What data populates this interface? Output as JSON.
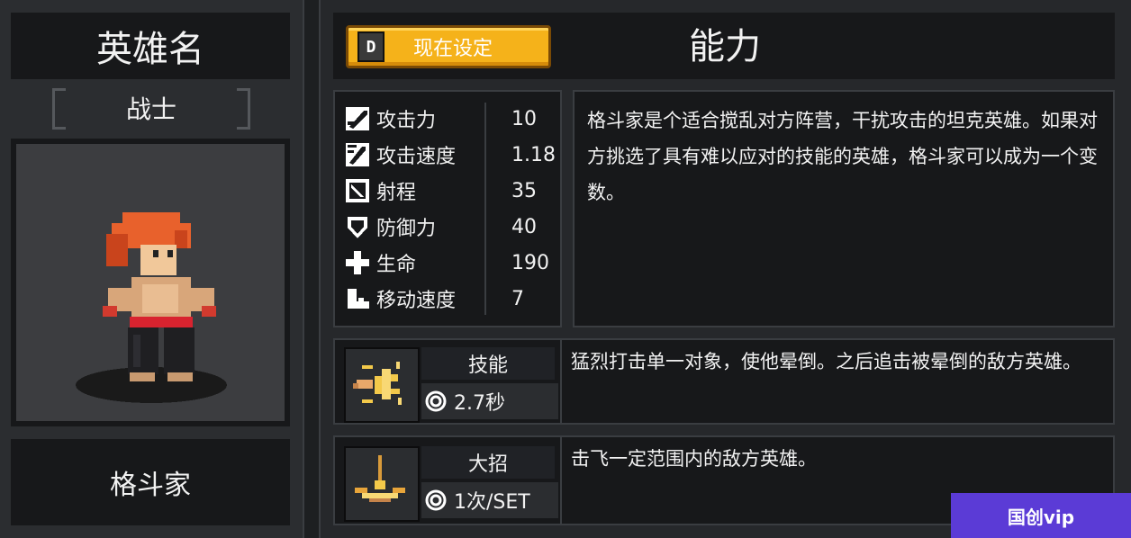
{
  "hero": {
    "title": "英雄名",
    "class": "战士",
    "name": "格斗家"
  },
  "header": {
    "set_button_key": "D",
    "set_button_label": "现在设定",
    "section_title": "能力"
  },
  "stats": [
    {
      "icon": "sword-icon",
      "label": "攻击力",
      "value": "10"
    },
    {
      "icon": "attack-speed-icon",
      "label": "攻击速度",
      "value": "1.18"
    },
    {
      "icon": "range-icon",
      "label": "射程",
      "value": "35"
    },
    {
      "icon": "shield-icon",
      "label": "防御力",
      "value": "40"
    },
    {
      "icon": "health-cross-icon",
      "label": "生命",
      "value": "190"
    },
    {
      "icon": "boot-icon",
      "label": "移动速度",
      "value": "7"
    }
  ],
  "description": "格斗家是个适合搅乱对方阵营，干扰攻击的坦克英雄。如果对方挑选了具有难以应对的技能的英雄，格斗家可以成为一个变数。",
  "skill": {
    "title": "技能",
    "cooldown": "2.7秒",
    "description": "猛烈打击单一对象，使他晕倒。之后追击被晕倒的敌方英雄。"
  },
  "ultimate": {
    "title": "大招",
    "cooldown": "1次/SET",
    "description": "击飞一定范围内的敌方英雄。"
  },
  "watermark": "国创vip",
  "colors": {
    "accent": "#f5b21a",
    "panel": "#17181a",
    "background": "#26282b"
  }
}
